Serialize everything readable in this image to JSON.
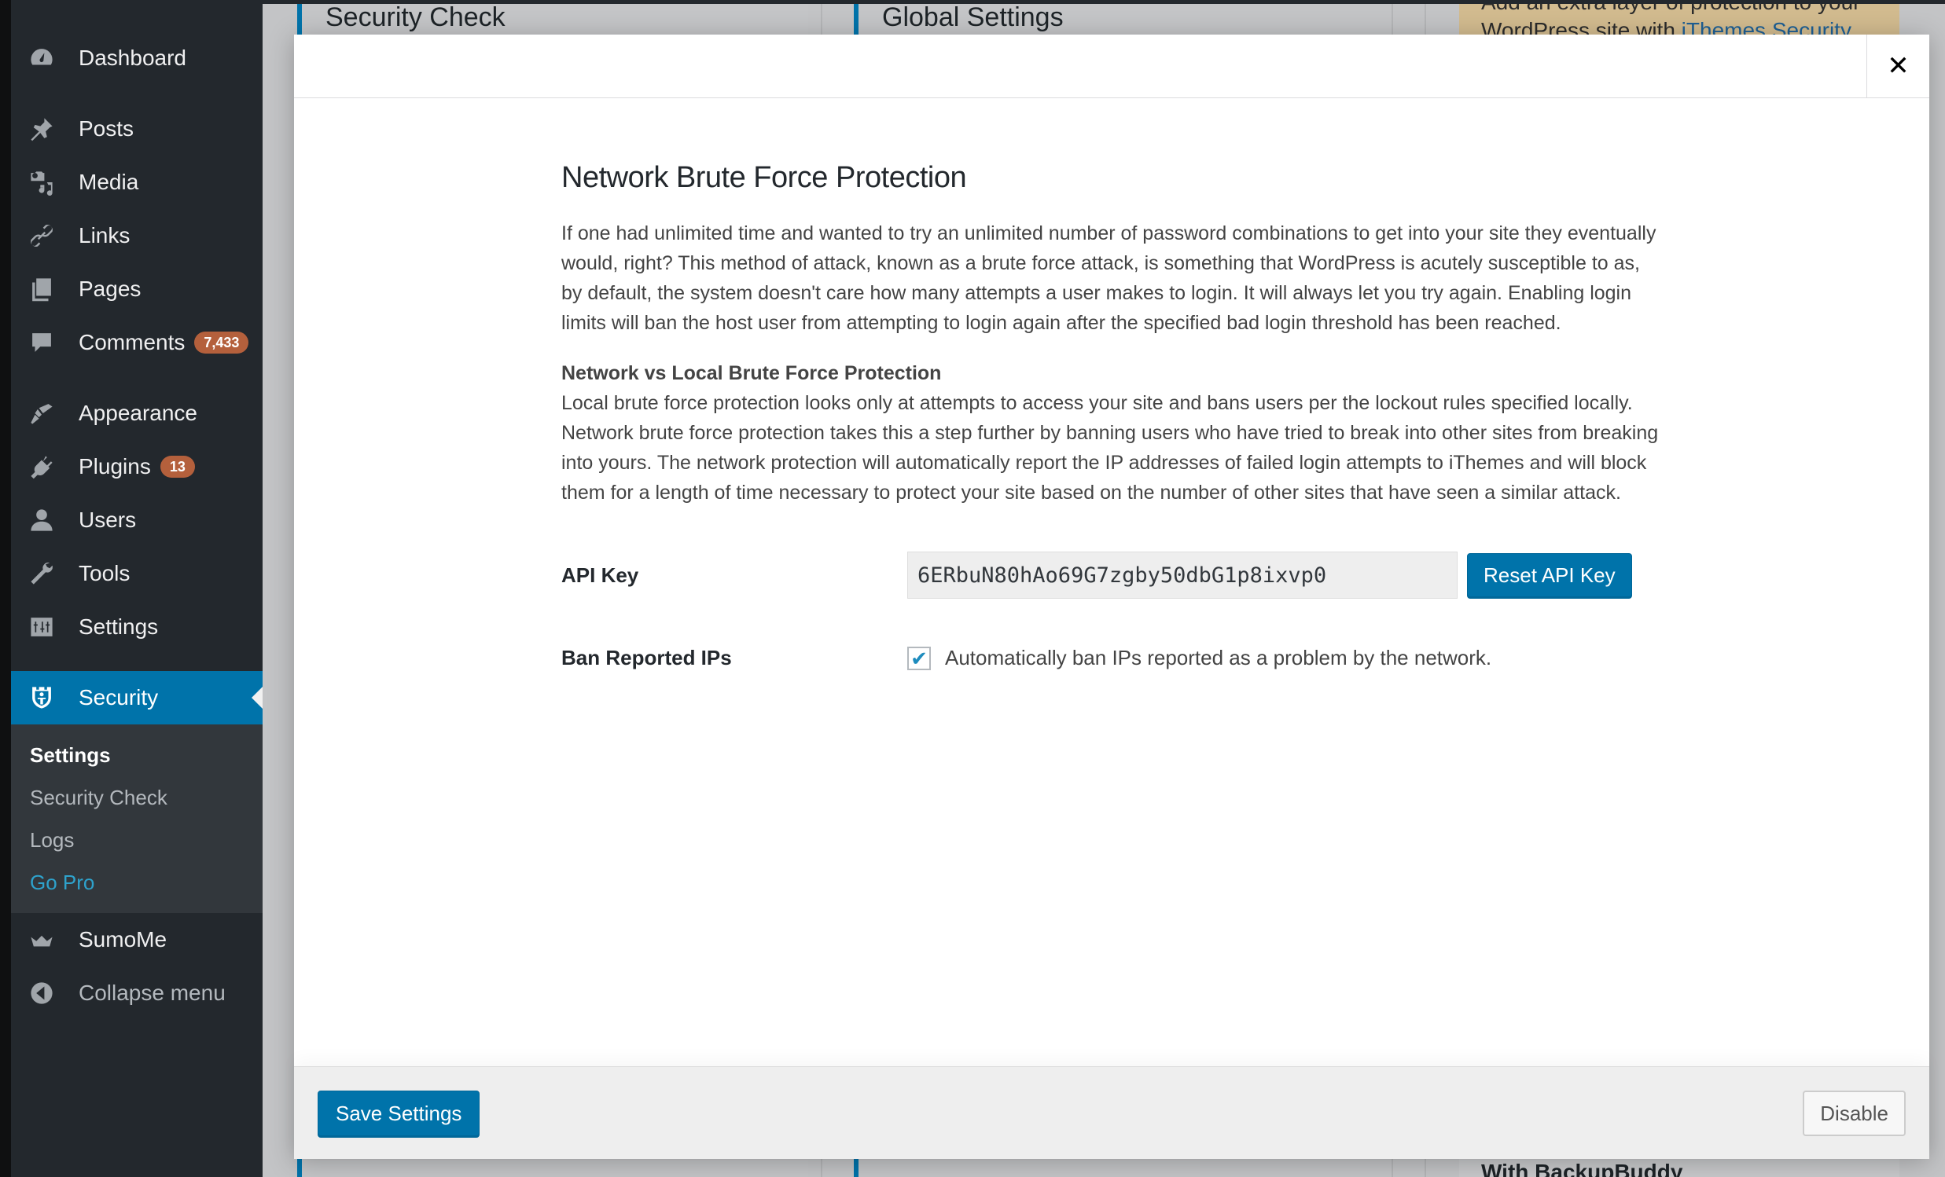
{
  "sidebar": {
    "items": [
      {
        "label": "Dashboard",
        "icon": "dashboard-icon"
      },
      {
        "label": "Posts",
        "icon": "pin-icon"
      },
      {
        "label": "Media",
        "icon": "media-icon"
      },
      {
        "label": "Links",
        "icon": "link-icon"
      },
      {
        "label": "Pages",
        "icon": "pages-icon"
      },
      {
        "label": "Comments",
        "icon": "comment-icon",
        "badge": "7,433"
      },
      {
        "label": "Appearance",
        "icon": "paintbrush-icon"
      },
      {
        "label": "Plugins",
        "icon": "plug-icon",
        "badge": "13"
      },
      {
        "label": "Users",
        "icon": "user-icon"
      },
      {
        "label": "Tools",
        "icon": "wrench-icon"
      },
      {
        "label": "Settings",
        "icon": "settings-icon"
      },
      {
        "label": "Security",
        "icon": "shield-icon",
        "active": true
      },
      {
        "label": "SumoMe",
        "icon": "crown-icon"
      },
      {
        "label": "Collapse menu",
        "icon": "collapse-arrow-icon"
      }
    ],
    "security_submenu": [
      {
        "label": "Settings",
        "current": true
      },
      {
        "label": "Security Check"
      },
      {
        "label": "Logs"
      },
      {
        "label": "Go Pro",
        "highlight": true
      }
    ]
  },
  "background": {
    "card1_title": "Security Check",
    "card2_title": "Global Settings",
    "notice_line1": "Add an extra layer of protection to your",
    "notice_line2_prefix": "WordPress site with ",
    "notice_link": "iThemes Security",
    "bottom_card_title": "With BackupBuddy"
  },
  "modal": {
    "close_label": "✕",
    "title": "Network Brute Force Protection",
    "intro": "If one had unlimited time and wanted to try an unlimited number of password combinations to get into your site they eventually would, right? This method of attack, known as a brute force attack, is something that WordPress is acutely susceptible to as, by default, the system doesn't care how many attempts a user makes to login. It will always let you try again. Enabling login limits will ban the host user from attempting to login again after the specified bad login threshold has been reached.",
    "subheading": "Network vs Local Brute Force Protection",
    "subtext": "Local brute force protection looks only at attempts to access your site and bans users per the lockout rules specified locally. Network brute force protection takes this a step further by banning users who have tried to break into other sites from breaking into yours. The network protection will automatically report the IP addresses of failed login attempts to iThemes and will block them for a length of time necessary to protect your site based on the number of other sites that have seen a similar attack.",
    "api_key_label": "API Key",
    "api_key_value": "6ERbuN80hAo69G7zgby50dbG1p8ixvp0",
    "reset_api_key_label": "Reset API Key",
    "ban_label": "Ban Reported IPs",
    "ban_checked": true,
    "ban_checkbox_text": "Automatically ban IPs reported as a problem by the network.",
    "save_label": "Save Settings",
    "disable_label": "Disable"
  },
  "colors": {
    "accent": "#0073aa",
    "sidebar_bg": "#23282d",
    "badge": "#b4603c",
    "go_pro": "#2ea2cc"
  }
}
